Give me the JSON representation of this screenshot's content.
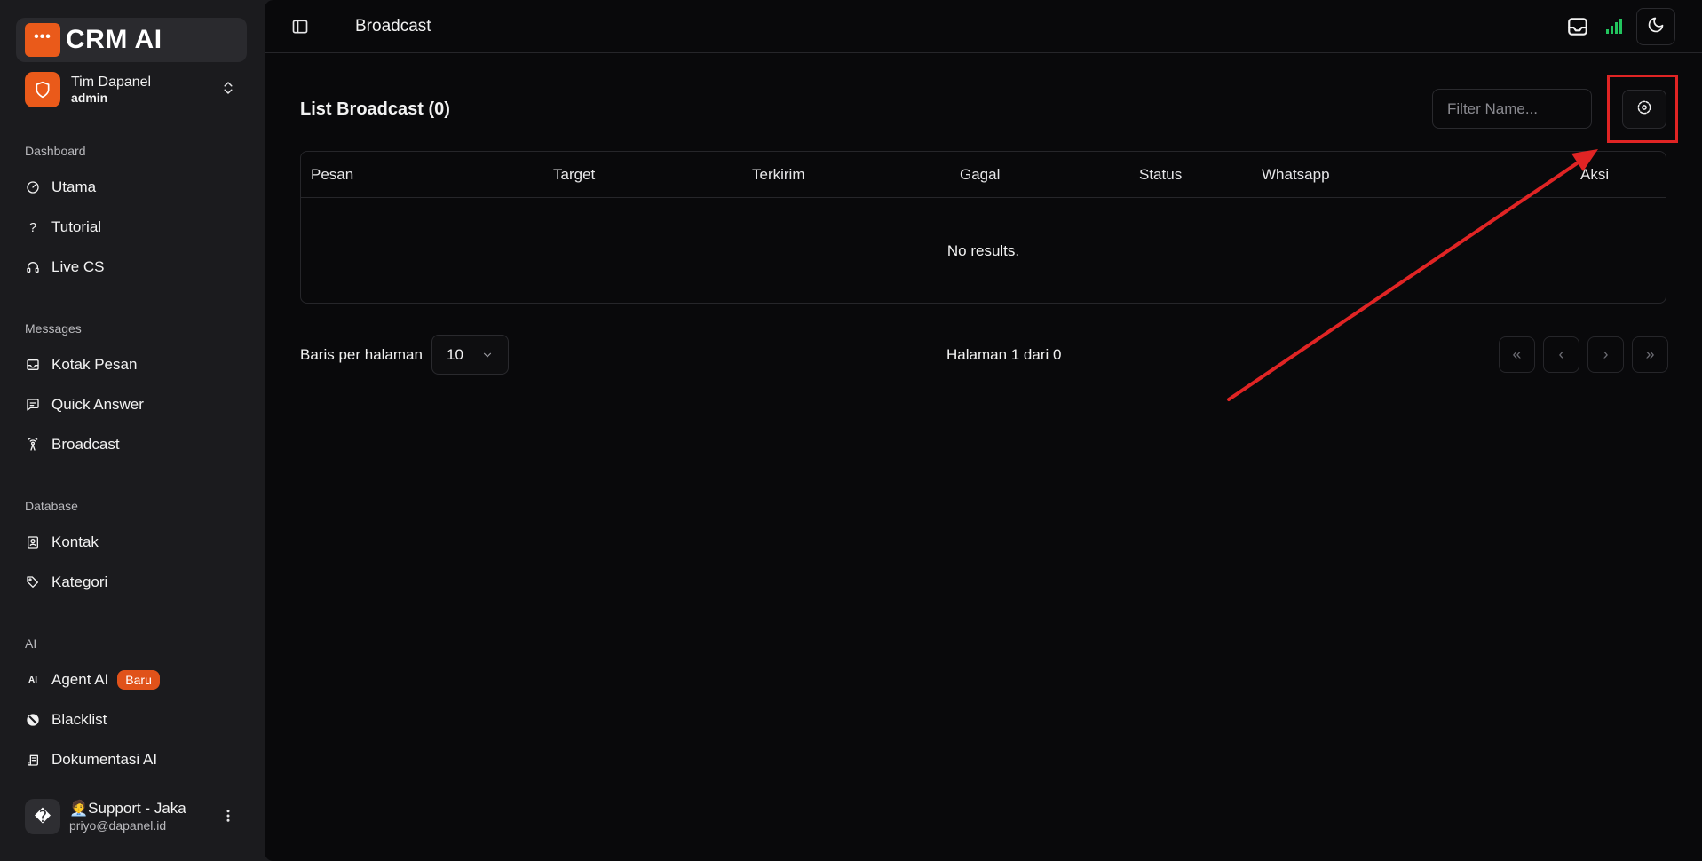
{
  "brand": {
    "name": "CRM AI",
    "logo_dots": "•••"
  },
  "team": {
    "name": "Tim Dapanel",
    "role": "admin"
  },
  "sidebar": {
    "sections": [
      {
        "label": "Dashboard",
        "items": [
          {
            "label": "Utama",
            "icon": "gauge-icon"
          },
          {
            "label": "Tutorial",
            "icon": "question-icon"
          },
          {
            "label": "Live CS",
            "icon": "headset-icon"
          }
        ]
      },
      {
        "label": "Messages",
        "items": [
          {
            "label": "Kotak Pesan",
            "icon": "inbox-icon"
          },
          {
            "label": "Quick Answer",
            "icon": "message-square-icon"
          },
          {
            "label": "Broadcast",
            "icon": "radio-tower-icon"
          }
        ]
      },
      {
        "label": "Database",
        "items": [
          {
            "label": "Kontak",
            "icon": "contact-icon"
          },
          {
            "label": "Kategori",
            "icon": "tag-icon"
          }
        ]
      },
      {
        "label": "AI",
        "items": [
          {
            "label": "Agent AI",
            "icon": "ai-icon",
            "badge": "Baru"
          },
          {
            "label": "Blacklist",
            "icon": "ban-icon"
          },
          {
            "label": "Dokumentasi AI",
            "icon": "scroll-icon"
          }
        ]
      }
    ]
  },
  "user": {
    "avatar_glyph": "�",
    "name": "Support - Jaka",
    "name_prefix": "🧑‍💼",
    "email": "priyo@dapanel.id"
  },
  "header": {
    "title": "Broadcast"
  },
  "content": {
    "list_title": "List Broadcast (0)",
    "filter_placeholder": "Filter Name...",
    "table": {
      "columns": [
        "Pesan",
        "Target",
        "Terkirim",
        "Gagal",
        "Status",
        "Whatsapp",
        "Aksi"
      ],
      "empty_text": "No results."
    },
    "pagination": {
      "rows_label": "Baris per halaman",
      "rows_value": "10",
      "page_info": "Halaman 1 dari 0",
      "buttons": [
        "«",
        "‹",
        "›",
        "»"
      ]
    }
  },
  "colors": {
    "accent": "#ea5a1a",
    "badge": "#e0521a",
    "signal": "#22c55e",
    "highlight": "#e02424"
  }
}
